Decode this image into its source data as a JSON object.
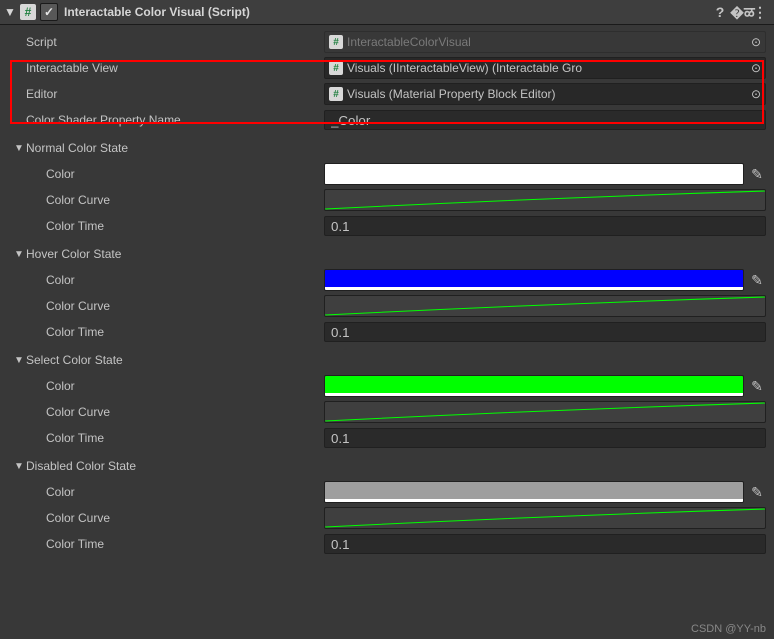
{
  "header": {
    "title": "Interactable Color Visual (Script)",
    "iconGlyph": "#",
    "checked": true
  },
  "props": {
    "script": {
      "label": "Script",
      "value": "InteractableColorVisual"
    },
    "interactableView": {
      "label": "Interactable View",
      "value": "Visuals (IInteractableView) (Interactable Gro"
    },
    "editor": {
      "label": "Editor",
      "value": "Visuals (Material Property Block Editor)"
    },
    "shaderProp": {
      "label": "Color Shader Property Name",
      "value": "_Color"
    }
  },
  "states": {
    "normal": {
      "title": "Normal Color State",
      "colorLabel": "Color",
      "curveLabel": "Color Curve",
      "timeLabel": "Color Time",
      "color": "#ffffff",
      "alpha": 100,
      "time": "0.1"
    },
    "hover": {
      "title": "Hover Color State",
      "colorLabel": "Color",
      "curveLabel": "Color Curve",
      "timeLabel": "Color Time",
      "color": "#0000ff",
      "alpha": 100,
      "time": "0.1"
    },
    "select": {
      "title": "Select Color State",
      "colorLabel": "Color",
      "curveLabel": "Color Curve",
      "timeLabel": "Color Time",
      "color": "#00ff00",
      "alpha": 100,
      "time": "0.1"
    },
    "disabled": {
      "title": "Disabled Color State",
      "colorLabel": "Color",
      "curveLabel": "Color Curve",
      "timeLabel": "Color Time",
      "color": "#9e9e9e",
      "alpha": 100,
      "time": "0.1"
    }
  },
  "watermark": "CSDN @YY-nb"
}
